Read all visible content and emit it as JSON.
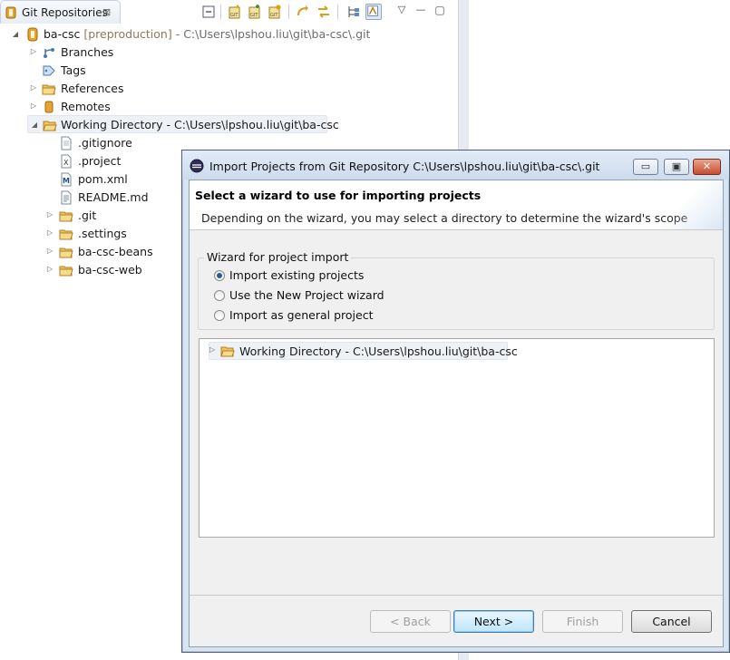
{
  "view": {
    "tab_label": "Git Repositories",
    "tab_close": "⊠",
    "toolbar_menu": "▽",
    "toolbar_minimize": "—",
    "toolbar_maximize": "▢"
  },
  "tree": {
    "repo_name": "ba-csc",
    "repo_branch": "[preproduction]",
    "repo_path": "- C:\\Users\\lpshou.liu\\git\\ba-csc\\.git",
    "items": [
      {
        "label": "Branches"
      },
      {
        "label": "Tags"
      },
      {
        "label": "References"
      },
      {
        "label": "Remotes"
      },
      {
        "label": "Working Directory - C:\\Users\\lpshou.liu\\git\\ba-csc"
      }
    ],
    "files": [
      {
        "label": ".gitignore"
      },
      {
        "label": ".project"
      },
      {
        "label": "pom.xml"
      },
      {
        "label": "README.md"
      },
      {
        "label": ".git"
      },
      {
        "label": ".settings"
      },
      {
        "label": "ba-csc-beans"
      },
      {
        "label": "ba-csc-web"
      }
    ]
  },
  "dialog": {
    "title": "Import Projects from Git Repository C:\\Users\\lpshou.liu\\git\\ba-csc\\.git",
    "header_title": "Select a wizard to use for importing projects",
    "header_desc": "Depending on the wizard, you may select a directory to determine the wizard's scope",
    "group_title": "Wizard for project import",
    "options": [
      {
        "label": "Import existing projects",
        "checked": true
      },
      {
        "label": "Use the New Project wizard",
        "checked": false
      },
      {
        "label": "Import as general project",
        "checked": false
      }
    ],
    "tree_item": "Working Directory - C:\\Users\\lpshou.liu\\git\\ba-csc",
    "buttons": {
      "back": "< Back",
      "next": "Next >",
      "finish": "Finish",
      "cancel": "Cancel"
    },
    "win_minimize": "▭",
    "win_restore": "▣",
    "win_close": "✕"
  }
}
